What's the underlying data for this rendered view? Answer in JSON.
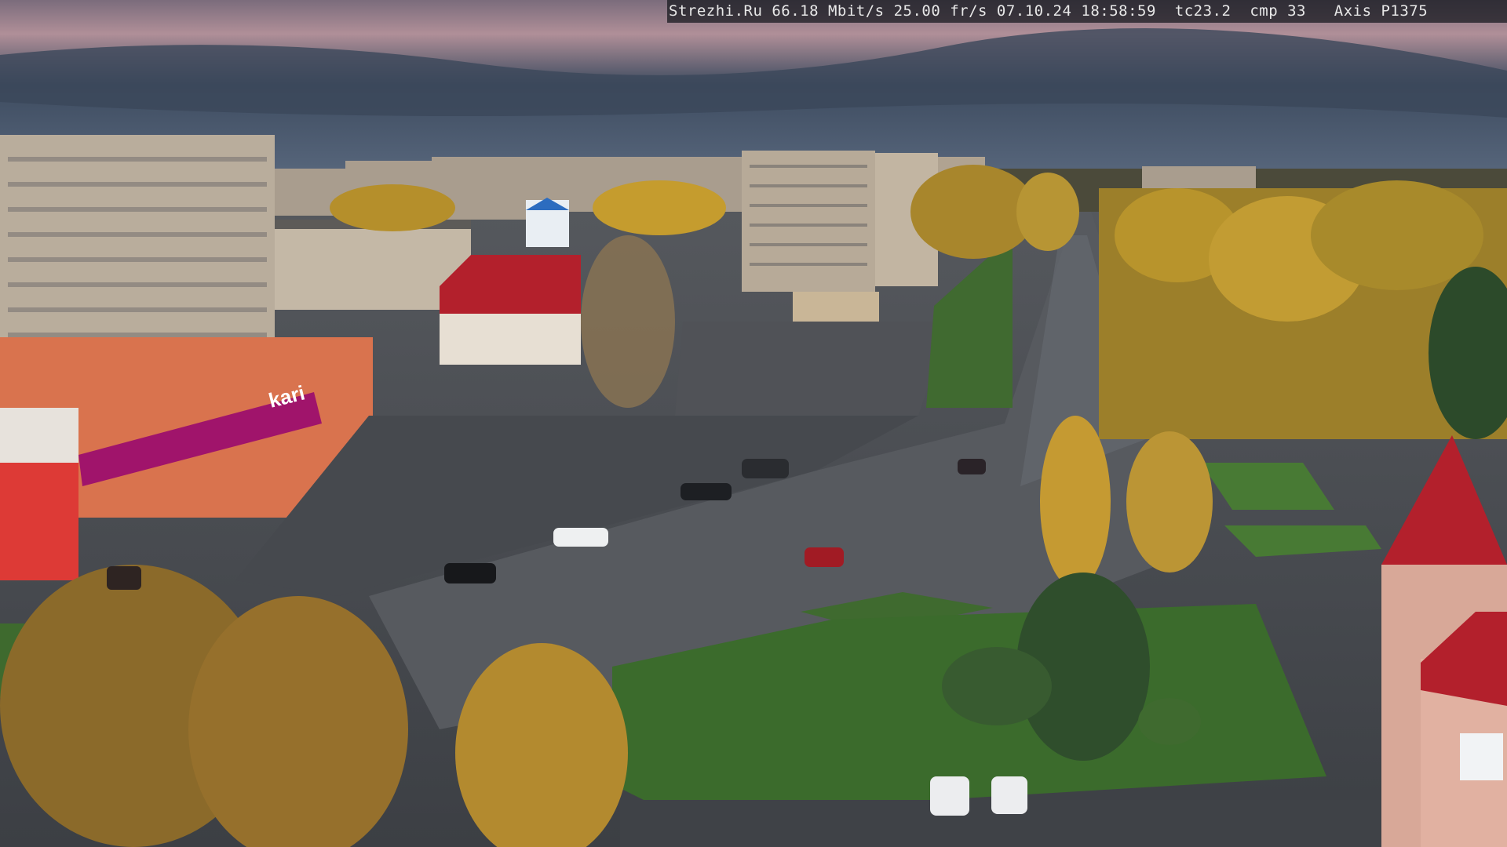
{
  "camera": {
    "site": "Strezhi.Ru",
    "bitrate": "66.18 Mbit/s",
    "framerate": "25.00 fr/s",
    "date": "07.10.24",
    "time": "18:58:59",
    "tc": "tc23.2",
    "cmp": "cmp 33",
    "model": "Axis P1375"
  },
  "scene": {
    "store_sign": "kari",
    "palette": {
      "sky_top": "#34404f",
      "sky_pink": "#c79aa0",
      "asphalt": "#4a4e55",
      "grass": "#3f6a2f",
      "foliage": "#b08a2a",
      "panel_building": "#b9ad9c",
      "store_front": "#d9734e",
      "store_banner": "#a0146b",
      "red_roof": "#b3202c"
    }
  }
}
